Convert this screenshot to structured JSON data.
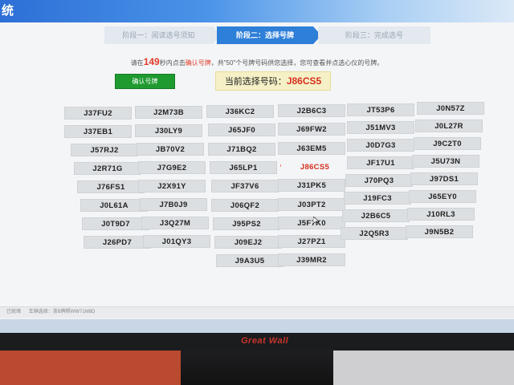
{
  "window": {
    "title": "统"
  },
  "steps": [
    {
      "label": "阶段一：阅读选号须知"
    },
    {
      "label": "阶段二：选择号牌"
    },
    {
      "label": "阶段三：完成选号"
    }
  ],
  "instruction": {
    "prefix": "请在",
    "countdown": "149",
    "mid": "秒内点击",
    "highlight": "确认号牌",
    "suffix": "，共\"50\"个号牌号码供您选择，您可查看并点选心仪的号牌。"
  },
  "confirm_button": "确认号牌",
  "current_selection": {
    "label": "当前选择号码：",
    "value": "J86CS5"
  },
  "plates": {
    "col1": [
      "J37FU2",
      "J37EB1",
      "J57RJ2",
      "J2R71G",
      "J76FS1",
      "J0L61A",
      "J0T9D7",
      "J26PD7"
    ],
    "col2": [
      "J2M73B",
      "J30LY9",
      "JB70V2",
      "J7G9E2",
      "J2X91Y",
      "J7B0J9",
      "J3Q27M",
      "J01QY3"
    ],
    "col3": [
      "J36KC2",
      "J65JF0",
      "J71BQ2",
      "J65LP1",
      "JF37V6",
      "J06QF2",
      "J95PS2",
      "J09EJ2",
      "J9A3U5"
    ],
    "col4": [
      "J2B6C3",
      "J69FW2",
      "J63EM5",
      "J86CS5",
      "J31PK5",
      "J03PT2",
      "J5F7K0",
      "J27PZ1",
      "J39MR2"
    ],
    "col5": [
      "JT53P6",
      "J51MV3",
      "J0D7G3",
      "JF17U1",
      "J70PQ3",
      "J19FC3",
      "J2B6C5",
      "J2Q5R3"
    ],
    "col6": [
      "J0N57Z",
      "J0L27R",
      "J9C2T0",
      "J5U73N",
      "J97DS1",
      "J65EY0",
      "J10RL3",
      "J9N5B2"
    ]
  },
  "selected_plate": "J86CS5",
  "status": {
    "left": "已就绪",
    "right": "车辆选择：浙B牌照WW71M8D"
  },
  "brand": "Great Wall",
  "colors": {
    "accent": "#2e7fd8",
    "confirm": "#1f9a2f",
    "highlight": "#d4301e"
  }
}
